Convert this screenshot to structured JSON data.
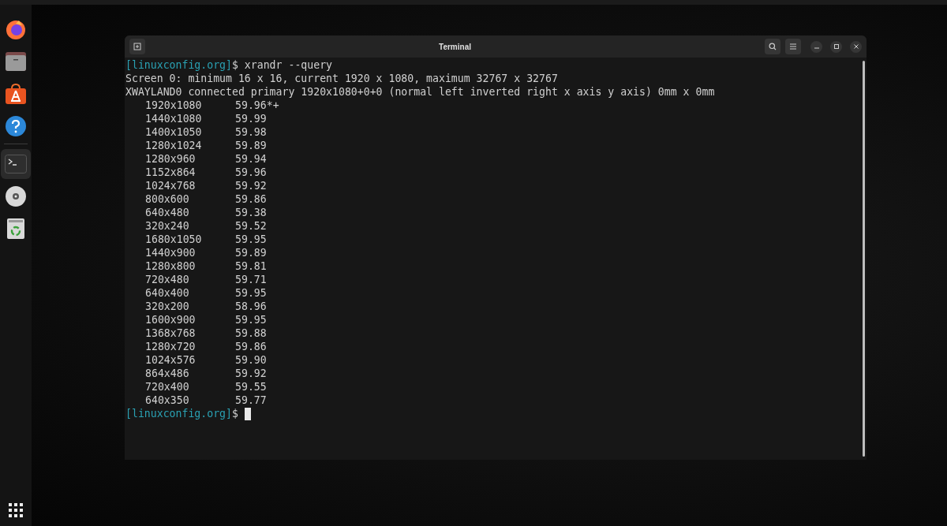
{
  "dock": {
    "items": [
      {
        "kind": "browser",
        "selected": false
      },
      {
        "kind": "files",
        "selected": false
      },
      {
        "kind": "store",
        "selected": false
      },
      {
        "kind": "help",
        "selected": false
      },
      {
        "kind": "terminal",
        "selected": true
      },
      {
        "kind": "disc",
        "selected": false
      },
      {
        "kind": "trash",
        "selected": false
      }
    ]
  },
  "terminal": {
    "title": "Terminal",
    "lines": [
      {
        "kind": "prompt",
        "prompt": "[linuxconfig.org]",
        "command": "$ xrandr --query"
      },
      {
        "kind": "output",
        "text": "Screen 0: minimum 16 x 16, current 1920 x 1080, maximum 32767 x 32767"
      },
      {
        "kind": "output",
        "text": "XWAYLAND0 connected primary 1920x1080+0+0 (normal left inverted right x axis y axis) 0mm x 0mm"
      },
      {
        "kind": "mode",
        "resolution": "1920x1080",
        "rate": "59.96*+"
      },
      {
        "kind": "mode",
        "resolution": "1440x1080",
        "rate": "59.99"
      },
      {
        "kind": "mode",
        "resolution": "1400x1050",
        "rate": "59.98"
      },
      {
        "kind": "mode",
        "resolution": "1280x1024",
        "rate": "59.89"
      },
      {
        "kind": "mode",
        "resolution": "1280x960",
        "rate": "59.94"
      },
      {
        "kind": "mode",
        "resolution": "1152x864",
        "rate": "59.96"
      },
      {
        "kind": "mode",
        "resolution": "1024x768",
        "rate": "59.92"
      },
      {
        "kind": "mode",
        "resolution": "800x600",
        "rate": "59.86"
      },
      {
        "kind": "mode",
        "resolution": "640x480",
        "rate": "59.38"
      },
      {
        "kind": "mode",
        "resolution": "320x240",
        "rate": "59.52"
      },
      {
        "kind": "mode",
        "resolution": "1680x1050",
        "rate": "59.95"
      },
      {
        "kind": "mode",
        "resolution": "1440x900",
        "rate": "59.89"
      },
      {
        "kind": "mode",
        "resolution": "1280x800",
        "rate": "59.81"
      },
      {
        "kind": "mode",
        "resolution": "720x480",
        "rate": "59.71"
      },
      {
        "kind": "mode",
        "resolution": "640x400",
        "rate": "59.95"
      },
      {
        "kind": "mode",
        "resolution": "320x200",
        "rate": "58.96"
      },
      {
        "kind": "mode",
        "resolution": "1600x900",
        "rate": "59.95"
      },
      {
        "kind": "mode",
        "resolution": "1368x768",
        "rate": "59.88"
      },
      {
        "kind": "mode",
        "resolution": "1280x720",
        "rate": "59.86"
      },
      {
        "kind": "mode",
        "resolution": "1024x576",
        "rate": "59.90"
      },
      {
        "kind": "mode",
        "resolution": "864x486",
        "rate": "59.92"
      },
      {
        "kind": "mode",
        "resolution": "720x400",
        "rate": "59.55"
      },
      {
        "kind": "mode",
        "resolution": "640x350",
        "rate": "59.77"
      },
      {
        "kind": "cursor",
        "prompt": "[linuxconfig.org]",
        "command": "$ "
      }
    ]
  }
}
